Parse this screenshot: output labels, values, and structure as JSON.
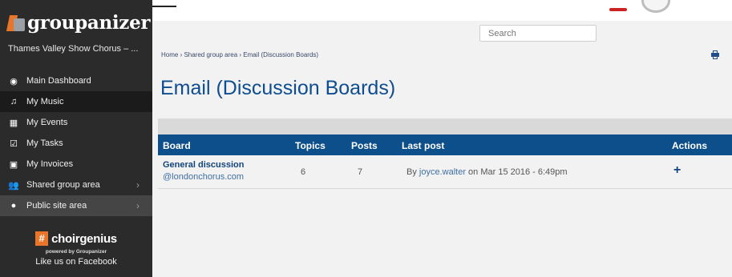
{
  "sidebar": {
    "brand": "groupanizer",
    "group_name": "Thames Valley Show Chorus – ...",
    "items": [
      {
        "label": "Main Dashboard",
        "icon": "dashboard-icon",
        "glyph": "◉"
      },
      {
        "label": "My Music",
        "icon": "music-icon",
        "glyph": "♫"
      },
      {
        "label": "My Events",
        "icon": "calendar-icon",
        "glyph": "▦"
      },
      {
        "label": "My Tasks",
        "icon": "checkbox-icon",
        "glyph": "☑"
      },
      {
        "label": "My Invoices",
        "icon": "invoice-icon",
        "glyph": "▣"
      },
      {
        "label": "Shared group area",
        "icon": "group-icon",
        "glyph": "👥",
        "chevron": "›"
      },
      {
        "label": "Public site area",
        "icon": "globe-icon",
        "glyph": "●",
        "chevron": "›"
      }
    ],
    "promo": {
      "logo_hash": "#",
      "logo_text": "choirgenius",
      "powered_by": "powered by Groupanizer",
      "facebook": "Like us on Facebook"
    }
  },
  "header": {
    "search_placeholder": "Search"
  },
  "breadcrumb": "Home › Shared group area › Email (Discussion Boards)",
  "page_title": "Email (Discussion Boards)",
  "table": {
    "columns": {
      "board": "Board",
      "topics": "Topics",
      "posts": "Posts",
      "last_post": "Last post",
      "actions": "Actions"
    },
    "rows": [
      {
        "board": "General discussion",
        "email": "@londonchorus.com",
        "topics": "6",
        "posts": "7",
        "last_post_prefix": "By ",
        "last_post_user": "joyce.walter",
        "last_post_suffix": " on Mar 15 2016 - 6:49pm",
        "action": "+"
      }
    ]
  },
  "colors": {
    "sidebar_bg": "#2b2b2b",
    "accent_orange": "#e8752a",
    "table_header": "#0d4f8b",
    "title_blue": "#0e4d8f"
  }
}
